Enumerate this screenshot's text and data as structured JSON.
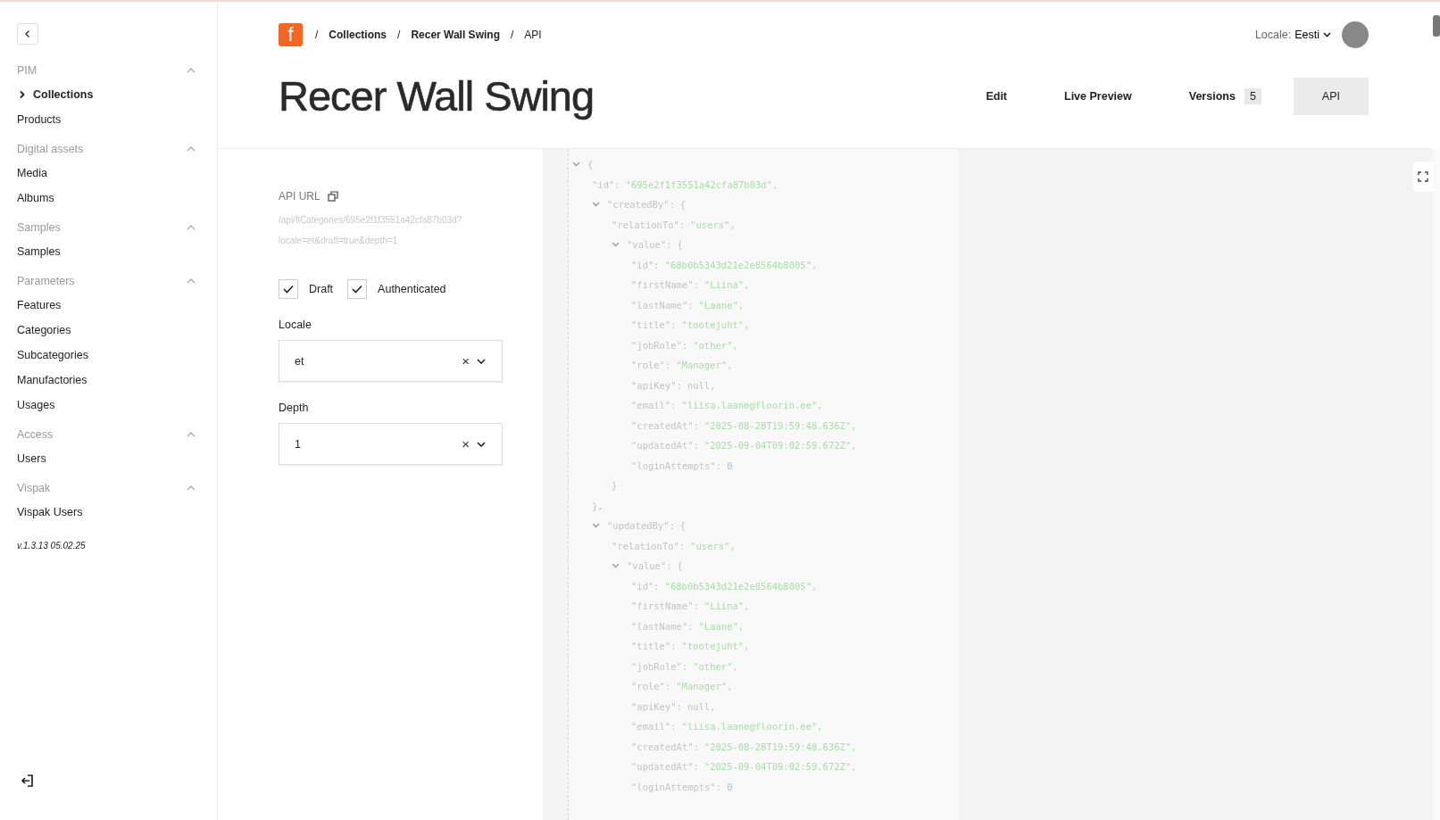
{
  "sidebar": {
    "groups": [
      {
        "title": "PIM",
        "expanded": true,
        "items": [
          {
            "label": "Collections",
            "selected": true
          },
          {
            "label": "Products",
            "selected": false
          }
        ]
      },
      {
        "title": "Digital assets",
        "expanded": true,
        "items": [
          {
            "label": "Media",
            "selected": false
          },
          {
            "label": "Albums",
            "selected": false
          }
        ]
      },
      {
        "title": "Samples",
        "expanded": true,
        "items": [
          {
            "label": "Samples",
            "selected": false
          }
        ]
      },
      {
        "title": "Parameters",
        "expanded": true,
        "items": [
          {
            "label": "Features",
            "selected": false
          },
          {
            "label": "Categories",
            "selected": false
          },
          {
            "label": "Subcategories",
            "selected": false
          },
          {
            "label": "Manufactories",
            "selected": false
          },
          {
            "label": "Usages",
            "selected": false
          }
        ]
      },
      {
        "title": "Access",
        "expanded": true,
        "items": [
          {
            "label": "Users",
            "selected": false
          }
        ]
      },
      {
        "title": "Vispak",
        "expanded": true,
        "items": [
          {
            "label": "Vispak Users",
            "selected": false
          }
        ]
      }
    ],
    "version": "v.1.3.13 05.02.25"
  },
  "logo": {
    "letter": "f"
  },
  "breadcrumb": [
    "/",
    "Collections",
    "/",
    "Recer Wall Swing",
    "/",
    "API"
  ],
  "locale": {
    "label": "Locale:",
    "value": "Eesti"
  },
  "title": "Recer Wall Swing",
  "tabs": [
    {
      "label": "Edit",
      "selected": false
    },
    {
      "label": "Live Preview",
      "selected": false
    },
    {
      "label": "Versions",
      "count": "5",
      "selected": false
    },
    {
      "label": "API",
      "selected": true
    }
  ],
  "api_url": {
    "label": "API URL",
    "lines": [
      "/api/fiCategories/695e2f1f3551a42cfa87b03d?",
      "locale=et&draft=true&depth=1"
    ]
  },
  "checkboxes": [
    {
      "label": "Draft",
      "checked": true
    },
    {
      "label": "Authenticated",
      "checked": true
    }
  ],
  "fields": [
    {
      "label": "Locale",
      "value": "et",
      "clear": "×"
    },
    {
      "label": "Depth",
      "value": "1",
      "clear": "×"
    }
  ],
  "json_view": {
    "root": {
      "open": "{",
      "expanded": true,
      "children": [
        {
          "key": "\"id\":",
          "value": "\"695e2f1f3551a42cfa87b03d\",",
          "kind": "string"
        },
        {
          "key": "\"createdBy\":",
          "open": "{",
          "expanded": true,
          "close": "},",
          "children": [
            {
              "key": "\"relationTo\":",
              "value": "\"users\",",
              "kind": "string"
            },
            {
              "key": "\"value\":",
              "open": "{",
              "expanded": true,
              "close": "}",
              "children": [
                {
                  "key": "\"id\":",
                  "value": "\"68b0b5343d21e2e8564b8005\",",
                  "kind": "string"
                },
                {
                  "key": "\"firstName\":",
                  "value": "\"Liina\",",
                  "kind": "string"
                },
                {
                  "key": "\"lastName\":",
                  "value": "\"Laane\",",
                  "kind": "string"
                },
                {
                  "key": "\"title\":",
                  "value": "\"tootejuht\",",
                  "kind": "string"
                },
                {
                  "key": "\"jobRole\":",
                  "value": "\"other\",",
                  "kind": "string"
                },
                {
                  "key": "\"role\":",
                  "value": "\"Manager\",",
                  "kind": "string"
                },
                {
                  "key": "\"apiKey\":",
                  "value": "null,",
                  "kind": "null"
                },
                {
                  "key": "\"email\":",
                  "value": "\"liisa.laane@floorin.ee\",",
                  "kind": "string"
                },
                {
                  "key": "\"createdAt\":",
                  "value": "\"2025-08-28T19:59:48.636Z\",",
                  "kind": "string"
                },
                {
                  "key": "\"updatedAt\":",
                  "value": "\"2025-09-04T09:02:59.672Z\",",
                  "kind": "string"
                },
                {
                  "key": "\"loginAttempts\":",
                  "value": "0",
                  "kind": "number"
                }
              ]
            }
          ]
        },
        {
          "key": "\"updatedBy\":",
          "open": "{",
          "expanded": true,
          "children": [
            {
              "key": "\"relationTo\":",
              "value": "\"users\",",
              "kind": "string"
            },
            {
              "key": "\"value\":",
              "open": "{",
              "expanded": true,
              "children": [
                {
                  "key": "\"id\":",
                  "value": "\"68b0b5343d21e2e8564b8005\",",
                  "kind": "string"
                },
                {
                  "key": "\"firstName\":",
                  "value": "\"Liina\",",
                  "kind": "string"
                },
                {
                  "key": "\"lastName\":",
                  "value": "\"Laane\",",
                  "kind": "string"
                },
                {
                  "key": "\"title\":",
                  "value": "\"tootejuht\",",
                  "kind": "string"
                },
                {
                  "key": "\"jobRole\":",
                  "value": "\"other\",",
                  "kind": "string"
                },
                {
                  "key": "\"role\":",
                  "value": "\"Manager\",",
                  "kind": "string"
                },
                {
                  "key": "\"apiKey\":",
                  "value": "null,",
                  "kind": "null"
                },
                {
                  "key": "\"email\":",
                  "value": "\"liisa.laane@floorin.ee\",",
                  "kind": "string"
                },
                {
                  "key": "\"createdAt\":",
                  "value": "\"2025-08-28T19:59:48.636Z\",",
                  "kind": "string"
                },
                {
                  "key": "\"updatedAt\":",
                  "value": "\"2025-09-04T09:02:59.672Z\",",
                  "kind": "string"
                },
                {
                  "key": "\"loginAttempts\":",
                  "value": "0",
                  "kind": "number"
                }
              ]
            }
          ]
        }
      ]
    }
  }
}
